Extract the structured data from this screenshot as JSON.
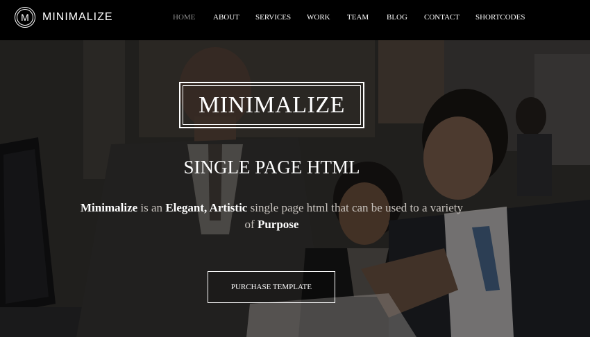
{
  "brand": {
    "logo_letter": "M",
    "name": "MINIMALIZE"
  },
  "nav": {
    "items": [
      {
        "label": "HOME",
        "active": true
      },
      {
        "label": "ABOUT",
        "active": false
      },
      {
        "label": "SERVICES",
        "active": false
      },
      {
        "label": "WORK",
        "active": false
      },
      {
        "label": "TEAM",
        "active": false
      },
      {
        "label": "BLOG",
        "active": false
      },
      {
        "label": "CONTACT",
        "active": false
      },
      {
        "label": "SHORTCODES",
        "active": false
      }
    ]
  },
  "hero": {
    "title": "MINIMALIZE",
    "subtitle": "SINGLE PAGE HTML",
    "description": {
      "part1_bold": "Minimalize",
      "part2": " is an ",
      "part3_bold": "Elegant, Artistic",
      "part4": " single page html that can be used to a variety of ",
      "part5_bold": "Purpose"
    },
    "button_label": "PURCHASE TEMPLATE",
    "background": "office-team-photo"
  },
  "colors": {
    "navbar_bg": "#000000",
    "nav_active": "#8e8e8e",
    "text": "#ffffff",
    "desc_text": "#c9c4bf"
  }
}
